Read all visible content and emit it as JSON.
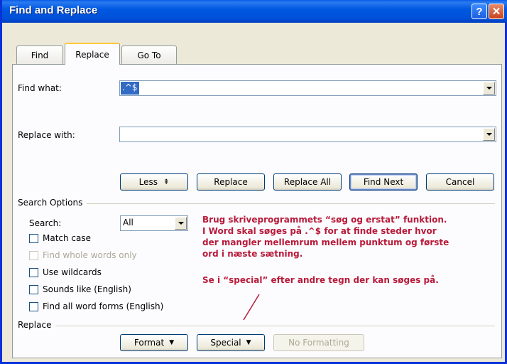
{
  "window": {
    "title": "Find and Replace",
    "help_glyph": "?",
    "close_glyph": "✕"
  },
  "tabs": [
    {
      "label": "Find",
      "active": false
    },
    {
      "label": "Replace",
      "active": true
    },
    {
      "label": "Go To",
      "active": false
    }
  ],
  "find": {
    "label": "Find what:",
    "value": ".^$"
  },
  "replace": {
    "label": "Replace with:",
    "value": ""
  },
  "buttons": {
    "less": "Less",
    "less_arrow": "⇞",
    "replace": "Replace",
    "replace_all": "Replace All",
    "find_next": "Find Next",
    "cancel": "Cancel"
  },
  "search_options": {
    "header": "Search Options",
    "search_label": "Search:",
    "search_value": "All",
    "checkboxes": [
      {
        "label": "Match case",
        "checked": false,
        "enabled": true
      },
      {
        "label": "Find whole words only",
        "checked": false,
        "enabled": false
      },
      {
        "label": "Use wildcards",
        "checked": false,
        "enabled": true
      },
      {
        "label": "Sounds like (English)",
        "checked": false,
        "enabled": true
      },
      {
        "label": "Find all word forms (English)",
        "checked": false,
        "enabled": true
      }
    ]
  },
  "replace_section": {
    "header": "Replace",
    "format": "Format",
    "special": "Special",
    "no_formatting": "No Formatting"
  },
  "annotation": {
    "lines": [
      "Brug skriveprogrammets “søg og erstat” funktion.",
      "I Word skal søges på .^$ for at finde steder hvor",
      "der mangler mellemrum mellem punktum og første",
      "ord i næste sætning."
    ],
    "line2": "Se i “special” efter andre tegn der kan søges på.",
    "color": "#b81a3a"
  }
}
